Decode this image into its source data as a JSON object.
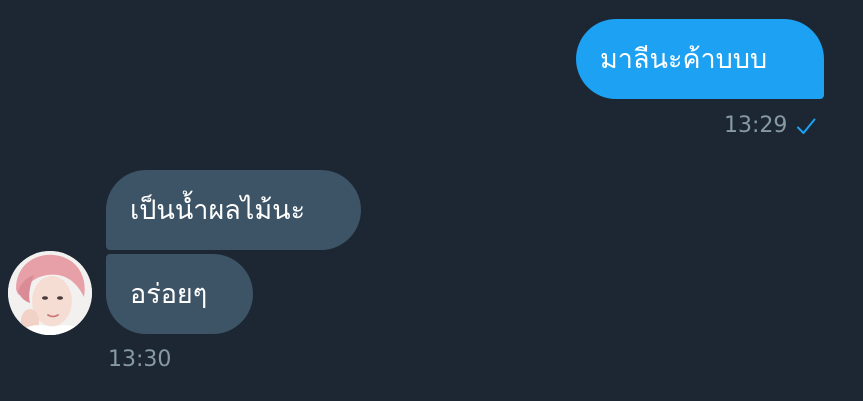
{
  "conversation": {
    "outgoing": {
      "text": "มาลีนะค้าบบบ",
      "time": "13:29",
      "status_icon": "check-icon"
    },
    "incoming": {
      "messages": [
        "เป็นน้ำผลไม้นะ",
        "อร่อยๆ"
      ],
      "time": "13:30",
      "avatar": "contact-avatar"
    }
  },
  "colors": {
    "background": "#1c2733",
    "outgoing_bubble": "#1da1f2",
    "incoming_bubble": "#3d5466",
    "timestamp": "#8899a6",
    "check": "#1da1f2"
  }
}
